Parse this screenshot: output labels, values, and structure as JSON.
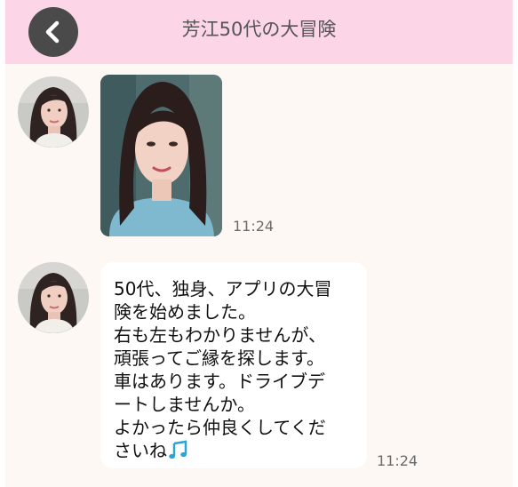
{
  "header": {
    "title": "芳江50代の大冒険",
    "back_icon": "chevron-left-icon",
    "bar_color": "#fcd6e6"
  },
  "messages": [
    {
      "type": "image",
      "content": "photo of a woman with shoulder-length dark hair",
      "time": "11:24"
    },
    {
      "type": "text",
      "lines": [
        "50代、独身、アプリの大冒",
        "険を始めました。",
        "右も左もわかりませんが、",
        "頑張ってご縁を探します。",
        "車はあります。ドライブデ",
        "ートしませんか。",
        "よかったら仲良くしてくだ",
        "さいね"
      ],
      "trailing_icon": "music-note-icon",
      "time": "11:24"
    }
  ]
}
